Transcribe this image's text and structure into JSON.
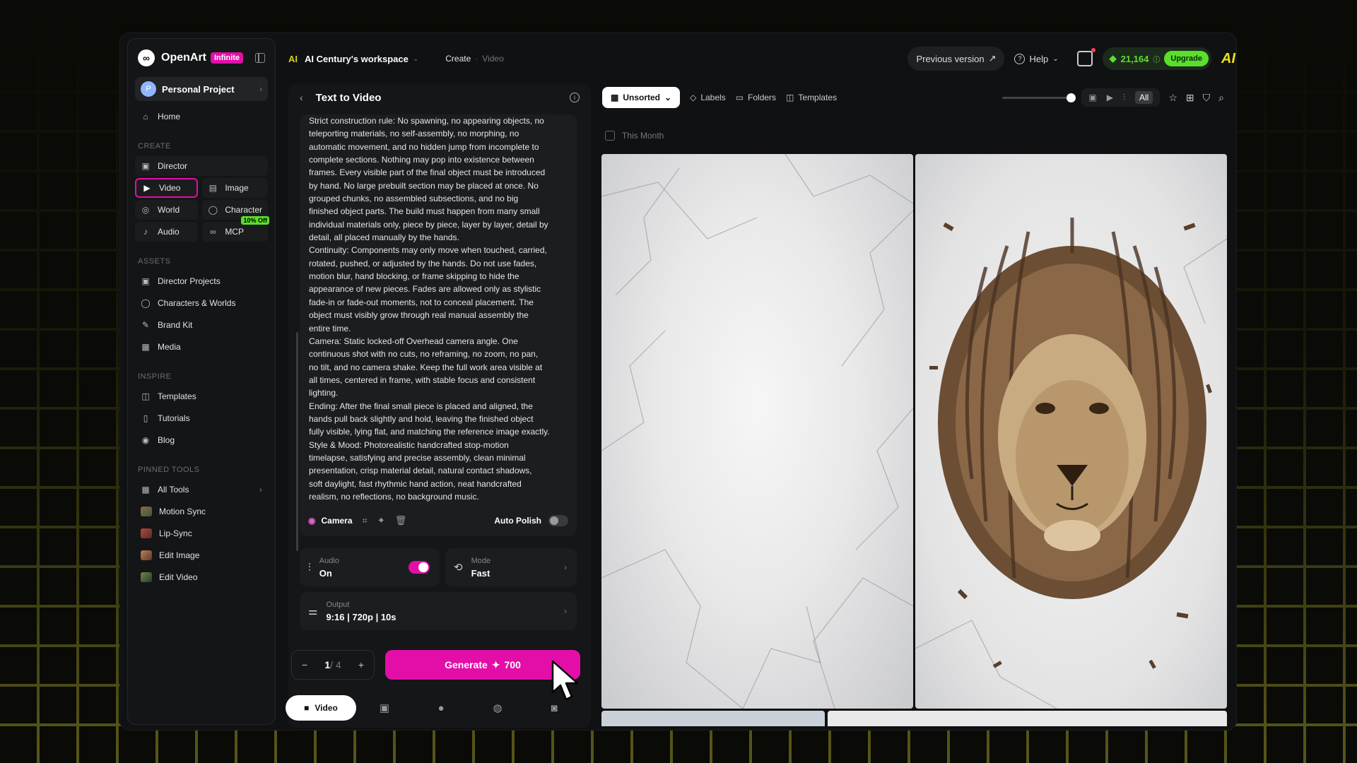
{
  "brand": {
    "name": "OpenArt",
    "badge": "Infinite"
  },
  "project": {
    "avatar": "P",
    "label": "Personal Project"
  },
  "sidebar": {
    "home": "Home",
    "create_header": "CREATE",
    "create": {
      "director": "Director",
      "video": "Video",
      "image": "Image",
      "world": "World",
      "character": "Character",
      "audio": "Audio",
      "mcp": "MCP",
      "mcp_badge": "10% Off"
    },
    "assets_header": "ASSETS",
    "assets": [
      "Director Projects",
      "Characters & Worlds",
      "Brand Kit",
      "Media"
    ],
    "inspire_header": "INSPIRE",
    "inspire": [
      "Templates",
      "Tutorials",
      "Blog"
    ],
    "pinned_header": "PINNED TOOLS",
    "pinned": [
      "All Tools",
      "Motion Sync",
      "Lip-Sync",
      "Edit Image",
      "Edit Video"
    ]
  },
  "topbar": {
    "ws_logo": "AI",
    "workspace": "AI Century's workspace",
    "crumb_create": "Create",
    "crumb_video": "Video",
    "previous_version": "Previous version",
    "help": "Help",
    "credits": "21,164",
    "upgrade": "Upgrade",
    "logo": "AI"
  },
  "panel": {
    "title": "Text to Video",
    "prompt": "Strict construction rule: No spawning, no appearing objects, no\nteleporting materials, no self-assembly, no morphing, no\nautomatic movement, and no hidden jump from incomplete to\ncomplete sections. Nothing may pop into existence between\nframes. Every visible part of the final object must be introduced\nby hand. No large prebuilt section may be placed at once. No\ngrouped chunks, no assembled subsections, and no big\nfinished object parts. The build must happen from many small\nindividual materials only, piece by piece, layer by layer, detail by\ndetail, all placed manually by the hands.\nContinuity: Components may only move when touched, carried,\nrotated, pushed, or adjusted by the hands. Do not use fades,\nmotion blur, hand blocking, or frame skipping to hide the\nappearance of new pieces. Fades are allowed only as stylistic\nfade-in or fade-out moments, not to conceal placement. The\nobject must visibly grow through real manual assembly the\nentire time.\nCamera: Static locked-off Overhead camera angle. One\ncontinuous shot with no cuts, no reframing, no zoom, no pan,\nno tilt, and no camera shake. Keep the full work area visible at\nall times, centered in frame, with stable focus and consistent\nlighting.\nEnding: After the final small piece is placed and aligned, the\nhands pull back slightly and hold, leaving the finished object\nfully visible, lying flat, and matching the reference image exactly.\nStyle & Mood: Photorealistic handcrafted stop-motion\ntimelapse, satisfying and precise assembly, clean minimal\npresentation, crisp material detail, natural contact shadows,\nsoft daylight, fast rhythmic hand action, neat handcrafted\nrealism, no reflections, no background music.",
    "camera": "Camera",
    "auto_polish": "Auto Polish",
    "audio_label": "Audio",
    "audio_value": "On",
    "mode_label": "Mode",
    "mode_value": "Fast",
    "output_label": "Output",
    "output_value": "9:16 | 720p | 10s",
    "count_current": "1",
    "count_total": "/ 4",
    "generate_label": "Generate",
    "generate_cost": "700",
    "tab_video": "Video"
  },
  "gallery": {
    "unsorted": "Unsorted",
    "labels": "Labels",
    "folders": "Folders",
    "templates": "Templates",
    "all": "All",
    "section": "This Month"
  },
  "colors": {
    "accent": "#e30ea8",
    "credit_green": "#5adf2b",
    "brand_yellow": "#e8e21a"
  }
}
